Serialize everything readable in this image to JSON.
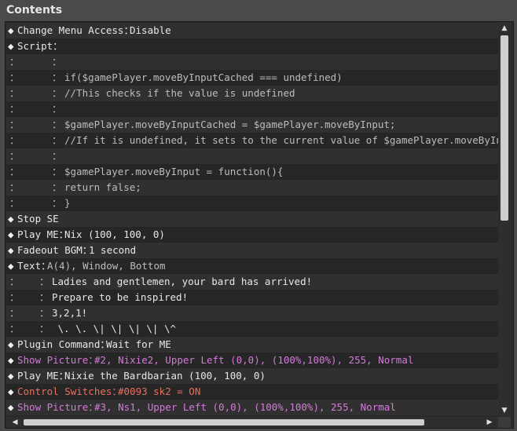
{
  "window": {
    "title": "Contents"
  },
  "rows": [
    {
      "prefix": "◆",
      "label": "Change Menu Access：",
      "value": "Disable",
      "color": "white"
    },
    {
      "prefix": "◆",
      "label": "Script：",
      "value": "",
      "color": "white"
    },
    {
      "prefix": "：",
      "indent": "：",
      "value": "",
      "color": "gray"
    },
    {
      "prefix": "：",
      "indent": "：",
      "value": "if($gamePlayer.moveByInputCached === undefined)",
      "color": "gray"
    },
    {
      "prefix": "：",
      "indent": "：",
      "value": "//This checks if the value is undefined",
      "color": "gray"
    },
    {
      "prefix": "：",
      "indent": "：",
      "value": "",
      "color": "gray"
    },
    {
      "prefix": "：",
      "indent": "：",
      "value": "$gamePlayer.moveByInputCached = $gamePlayer.moveByInput;",
      "color": "gray"
    },
    {
      "prefix": "：",
      "indent": "：",
      "value": "//If it is undefined, it sets to the current value of $gamePlayer.moveByInput wh",
      "color": "gray"
    },
    {
      "prefix": "：",
      "indent": "：",
      "value": "",
      "color": "gray"
    },
    {
      "prefix": "：",
      "indent": "：",
      "value": "$gamePlayer.moveByInput = function(){",
      "color": "gray"
    },
    {
      "prefix": "：",
      "indent": "：",
      "value": "return false;",
      "color": "gray"
    },
    {
      "prefix": "：",
      "indent": "：",
      "value": "}",
      "color": "gray"
    },
    {
      "prefix": "◆",
      "label": "Stop SE",
      "value": "",
      "color": "white"
    },
    {
      "prefix": "◆",
      "label": "Play ME：",
      "value": "Nix (100, 100, 0)",
      "color": "white"
    },
    {
      "prefix": "◆",
      "label": "Fadeout BGM：",
      "value": "1 second",
      "color": "white"
    },
    {
      "prefix": "◆",
      "label": "Text：",
      "value": "A(4), Window, Bottom",
      "color": "white-gray"
    },
    {
      "prefix": "：",
      "indent2": "：",
      "value": "Ladies and gentlemen, your bard has arrived!",
      "color": "white"
    },
    {
      "prefix": "：",
      "indent2": "：",
      "value": "Prepare to be inspired!",
      "color": "white"
    },
    {
      "prefix": "：",
      "indent2": "：",
      "value": "3,2,1!",
      "color": "white"
    },
    {
      "prefix": "：",
      "indent2": "：",
      "value": " \\. \\. \\| \\| \\| \\| \\^",
      "color": "white"
    },
    {
      "prefix": "◆",
      "label": "Plugin Command：",
      "value": "Wait for ME",
      "color": "white"
    },
    {
      "prefix": "◆",
      "label": "Show Picture：",
      "value": "#2, Nixie2, Upper Left (0,0), (100%,100%), 255, Normal",
      "color": "pink"
    },
    {
      "prefix": "◆",
      "label": "Play ME：",
      "value": "Nixie the Bardbarian (100, 100, 0)",
      "color": "white"
    },
    {
      "prefix": "◆",
      "label": "Control Switches：",
      "value": "#0093 sk2 = ON",
      "color": "red"
    },
    {
      "prefix": "◆",
      "label": "Show Picture：",
      "value": "#3, Ns1, Upper Left (0,0), (100%,100%), 255, Normal",
      "color": "pink"
    }
  ],
  "scroll": {
    "up": "▲",
    "down": "▼",
    "left": "◀",
    "right": "▶"
  },
  "colors": {
    "pink": "#d37ad9",
    "red": "#e8705f",
    "gray": "#bdbdbd",
    "white": "#e8e8e8"
  }
}
